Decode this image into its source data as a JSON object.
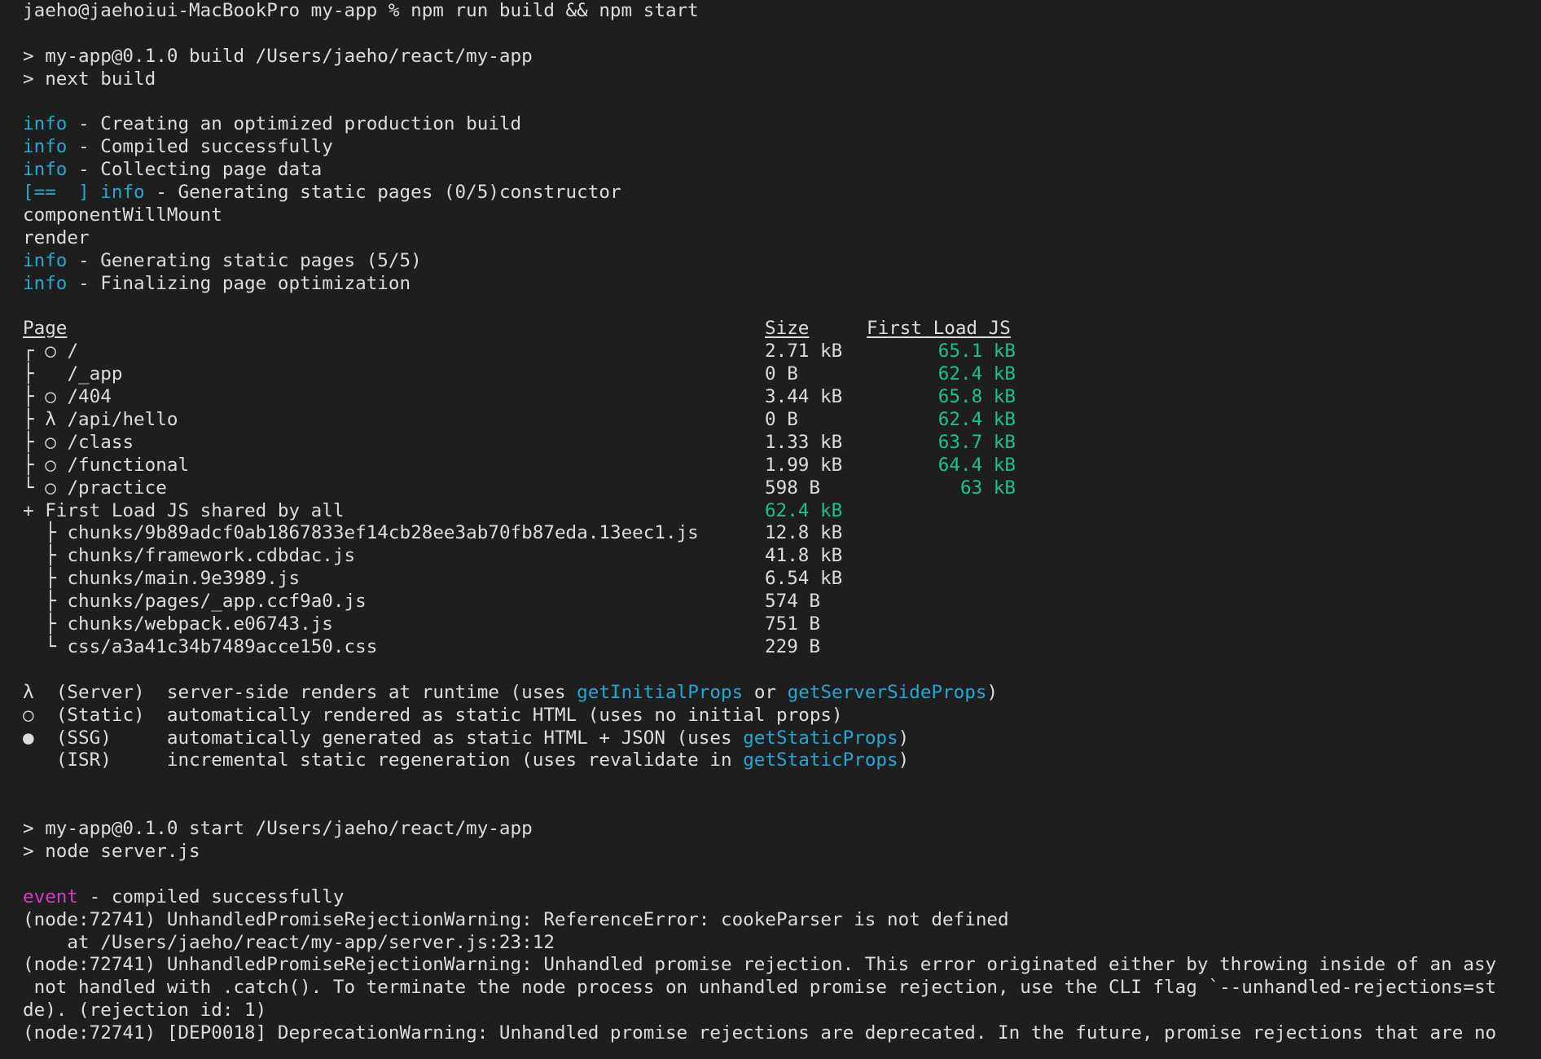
{
  "cmd": "jaeho@jaehoiui-MacBookPro my-app % npm run build && npm start",
  "build": {
    "pkg": "> my-app@0.1.0 build /Users/jaeho/react/my-app",
    "run": "> next build"
  },
  "info_tag": "info",
  "progress": "[==  ]",
  "logs": [
    " - Creating an optimized production build",
    " - Compiled successfully",
    " - Collecting page data"
  ],
  "gen_progress": " - Generating static pages (0/5)constructor",
  "lifecycle": [
    "componentWillMount",
    "render"
  ],
  "logs2": [
    " - Generating static pages (5/5)",
    " - Finalizing page optimization"
  ],
  "table": {
    "h_page": "Page",
    "h_size": "Size",
    "h_first": "First Load JS",
    "rows": [
      {
        "tree": "┌",
        "sym": "○",
        "route": "/",
        "size": "2.71 kB",
        "first": "65.1 kB"
      },
      {
        "tree": "├",
        "sym": " ",
        "route": "/_app",
        "size": "0 B",
        "first": "62.4 kB"
      },
      {
        "tree": "├",
        "sym": "○",
        "route": "/404",
        "size": "3.44 kB",
        "first": "65.8 kB"
      },
      {
        "tree": "├",
        "sym": "λ",
        "route": "/api/hello",
        "size": "0 B",
        "first": "62.4 kB"
      },
      {
        "tree": "├",
        "sym": "○",
        "route": "/class",
        "size": "1.33 kB",
        "first": "63.7 kB"
      },
      {
        "tree": "├",
        "sym": "○",
        "route": "/functional",
        "size": "1.99 kB",
        "first": "64.4 kB"
      },
      {
        "tree": "└",
        "sym": "○",
        "route": "/practice",
        "size": "598 B",
        "first": "63 kB"
      }
    ],
    "shared_label": "+ First Load JS shared by all",
    "shared_size": "62.4 kB",
    "chunks": [
      {
        "tree": "├",
        "name": "chunks/9b89adcf0ab1867833ef14cb28ee3ab70fb87eda.13eec1.js",
        "size": "12.8 kB"
      },
      {
        "tree": "├",
        "name": "chunks/framework.cdbdac.js",
        "size": "41.8 kB"
      },
      {
        "tree": "├",
        "name": "chunks/main.9e3989.js",
        "size": "6.54 kB"
      },
      {
        "tree": "├",
        "name": "chunks/pages/_app.ccf9a0.js",
        "size": "574 B"
      },
      {
        "tree": "├",
        "name": "chunks/webpack.e06743.js",
        "size": "751 B"
      },
      {
        "tree": "└",
        "name": "css/a3a41c34b7489acce150.css",
        "size": "229 B"
      }
    ]
  },
  "legend": {
    "server": {
      "sym": "λ",
      "kind": "(Server)",
      "text": "server-side renders at runtime (uses ",
      "fn1": "getInitialProps",
      "mid": " or ",
      "fn2": "getServerSideProps",
      "end": ")"
    },
    "static": {
      "sym": "○",
      "kind": "(Static)",
      "text": "automatically rendered as static HTML (uses no initial props)"
    },
    "ssg": {
      "sym": "●",
      "kind": "(SSG)",
      "text": "automatically generated as static HTML + JSON (uses ",
      "fn": "getStaticProps",
      "end": ")"
    },
    "isr": {
      "sym": " ",
      "kind": "(ISR)",
      "text": "incremental static regeneration (uses revalidate in ",
      "fn": "getStaticProps",
      "end": ")"
    }
  },
  "start": {
    "pkg": "> my-app@0.1.0 start /Users/jaeho/react/my-app",
    "run": "> node server.js"
  },
  "event_tag": "event",
  "event_msg": " - compiled successfully",
  "errors": [
    "(node:72741) UnhandledPromiseRejectionWarning: ReferenceError: cookeParser is not defined",
    "    at /Users/jaeho/react/my-app/server.js:23:12",
    "(node:72741) UnhandledPromiseRejectionWarning: Unhandled promise rejection. This error originated either by throwing inside of an asy",
    " not handled with .catch(). To terminate the node process on unhandled promise rejection, use the CLI flag `--unhandled-rejections=st",
    "de). (rejection id: 1)",
    "(node:72741) [DEP0018] DeprecationWarning: Unhandled promise rejections are deprecated. In the future, promise rejections that are no"
  ],
  "colors": {
    "bg": "#1e1e1e",
    "fg": "#dcdcdc",
    "cyan": "#23a8d2",
    "green": "#18c38c",
    "magenta": "#d33ec0"
  }
}
